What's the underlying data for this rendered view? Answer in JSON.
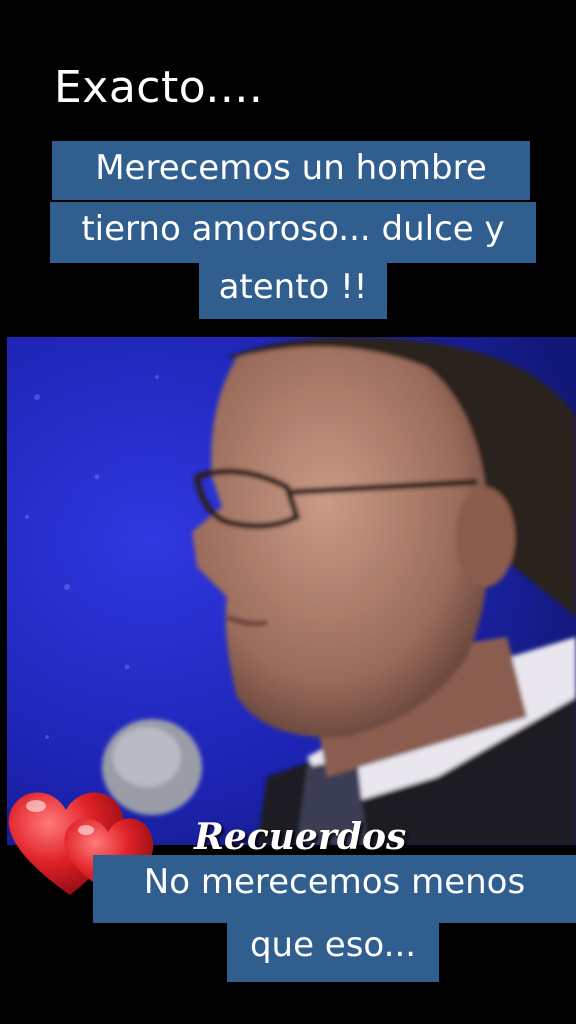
{
  "headline": "Exacto....",
  "top_caption": {
    "line1": "Merecemos un hombre",
    "line2": "tierno amoroso... dulce y",
    "line3": "atento !!"
  },
  "watermark": "Recuerdos",
  "bottom_caption": {
    "line1": "No merecemos menos",
    "line2": "que eso..."
  },
  "colors": {
    "caption_bg": "#2f5e8f",
    "video_bg": "#1e25b8",
    "heart": "#d81f26"
  },
  "icons": [
    "hearts-decoration-icon"
  ]
}
